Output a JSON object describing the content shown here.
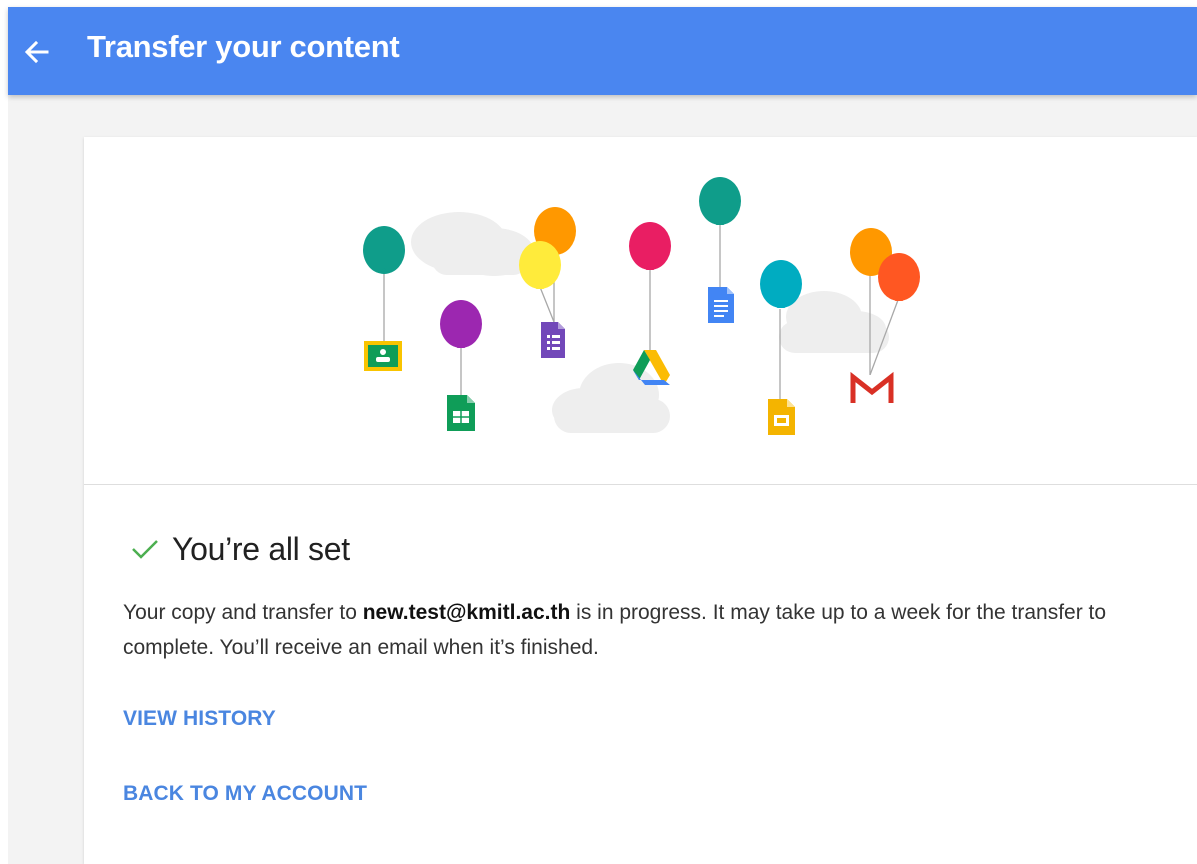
{
  "header": {
    "title": "Transfer your content",
    "back_icon": "arrow-back-icon",
    "color": "#4a86f0"
  },
  "illustration": {
    "icons": [
      "classroom-icon",
      "sheets-icon",
      "forms-icon",
      "drive-icon",
      "docs-icon",
      "slides-icon",
      "gmail-icon"
    ],
    "balloon_colors": [
      "#0f9d8a",
      "#9c27b0",
      "#ff9800",
      "#ffeb3b",
      "#e91e63",
      "#00acc1",
      "#ff5722"
    ]
  },
  "status": {
    "icon": "check-icon",
    "title": "You’re all set",
    "check_color": "#4caf50"
  },
  "message": {
    "prefix": "Your copy and transfer to ",
    "email": "new.test@kmitl.ac.th",
    "suffix": " is in progress. It may take up to a week for the transfer to complete. You’ll receive an email when it’s finished."
  },
  "actions": {
    "view_history": "VIEW HISTORY",
    "back_to_account": "BACK TO MY ACCOUNT",
    "link_color": "#4a86e0"
  }
}
